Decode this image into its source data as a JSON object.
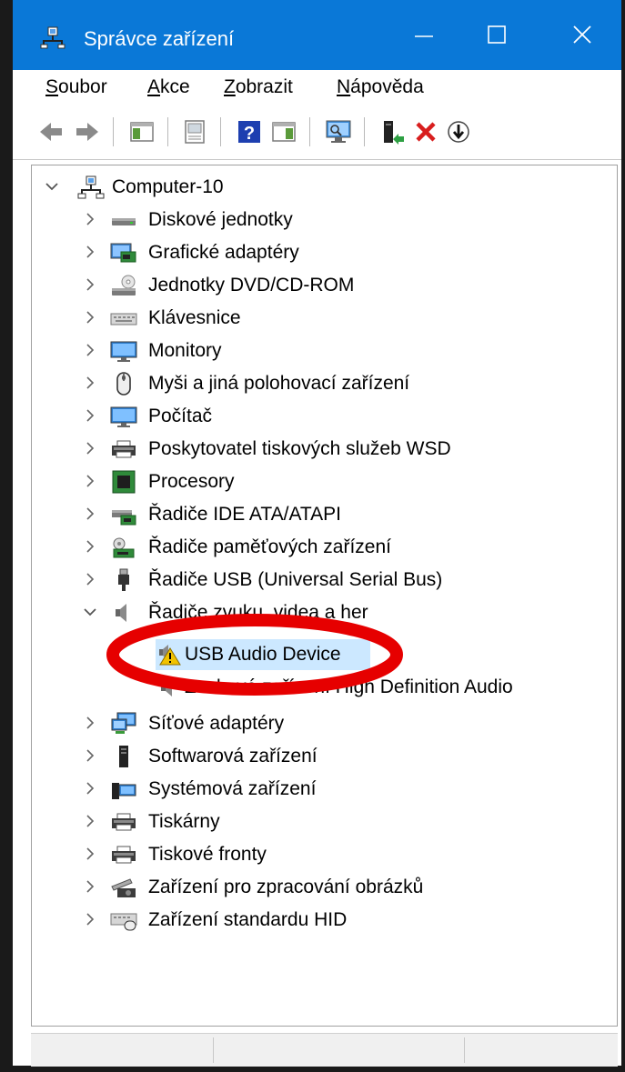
{
  "window": {
    "title": "Správce zařízení",
    "app_icon": "device-manager-icon",
    "accent": "#0a78d7"
  },
  "menu": {
    "items": [
      {
        "pre": "",
        "acc": "S",
        "post": "oubor"
      },
      {
        "pre": "",
        "acc": "A",
        "post": "kce"
      },
      {
        "pre": "",
        "acc": "Z",
        "post": "obrazit"
      },
      {
        "pre": "",
        "acc": "N",
        "post": "ápověda"
      }
    ]
  },
  "toolbar": {
    "buttons": [
      "back-arrow-icon",
      "forward-arrow-icon",
      "show-hide-console-tree-icon",
      "properties-icon",
      "help-icon",
      "action-pane-icon",
      "scan-hardware-icon",
      "update-driver-icon",
      "uninstall-device-icon",
      "disable-device-icon"
    ]
  },
  "tree": {
    "root": "Computer-10",
    "categories": [
      "Diskové jednotky",
      "Grafické adaptéry",
      "Jednotky DVD/CD-ROM",
      "Klávesnice",
      "Monitory",
      "Myši a jiná polohovací zařízení",
      "Počítač",
      "Poskytovatel tiskových služeb WSD",
      "Procesory",
      "Řadiče IDE ATA/ATAPI",
      "Řadiče paměťových zařízení",
      "Řadiče USB (Universal Serial Bus)",
      "Řadiče zvuku, videa a her",
      "Síťové adaptéry",
      "Softwarová zařízení",
      "Systémová zařízení",
      "Tiskárny",
      "Tiskové fronty",
      "Zařízení pro zpracování obrázků",
      "Zařízení standardu HID"
    ],
    "expanded_children": [
      "USB Audio Device",
      "Zvukové zařízení High Definition Audio"
    ],
    "selected": "USB Audio Device",
    "warning_color": "#f2c200",
    "annotation_color": "#e60000"
  }
}
